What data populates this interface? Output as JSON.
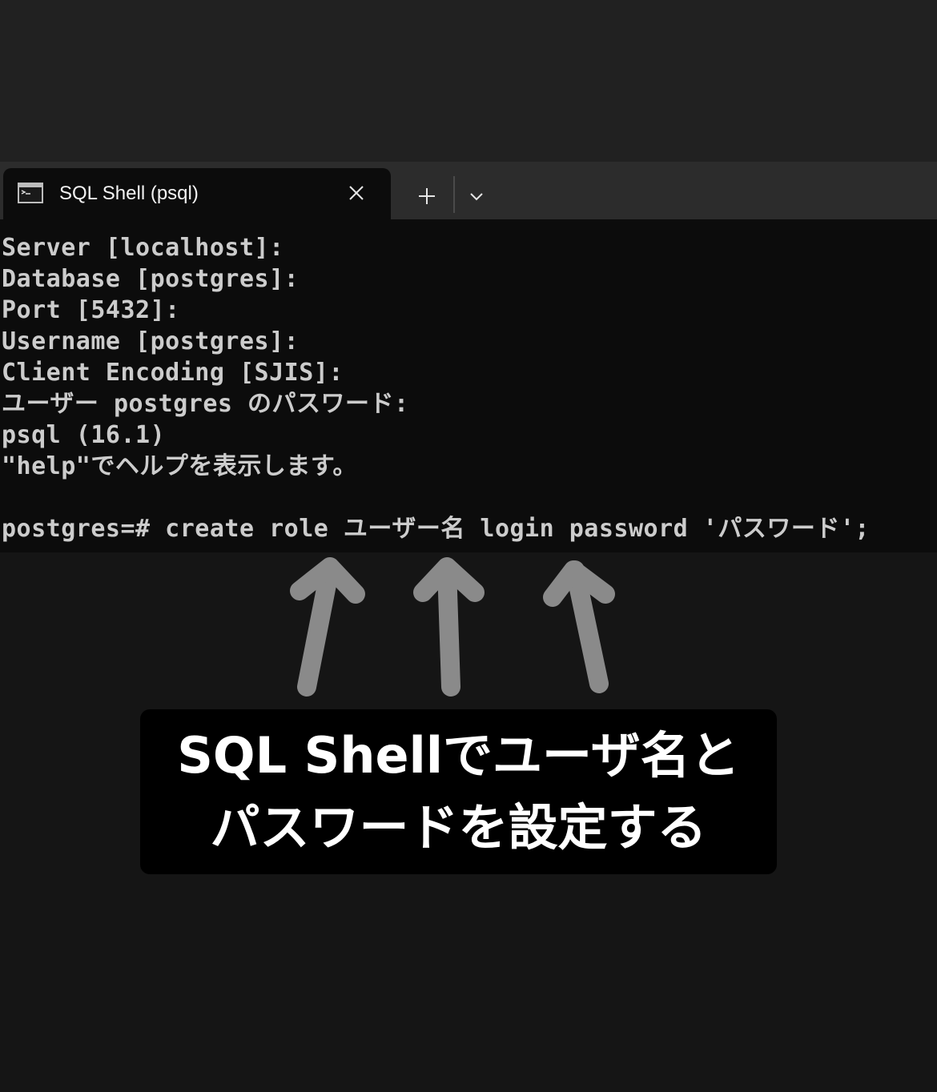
{
  "tab": {
    "title": "SQL Shell (psql)",
    "icon": "terminal-icon"
  },
  "tabbar": {
    "close_icon": "close-icon",
    "new_tab_icon": "plus-icon",
    "dropdown_icon": "chevron-down-icon"
  },
  "console": {
    "lines": [
      "Server [localhost]:",
      "Database [postgres]:",
      "Port [5432]:",
      "Username [postgres]:",
      "Client Encoding [SJIS]:",
      "ユーザー postgres のパスワード:",
      "psql (16.1)",
      "\"help\"でヘルプを表示します。",
      "",
      "postgres=# create role ユーザー名 login password 'パスワード';"
    ]
  },
  "annotation": {
    "arrows": [
      "arrow-up-icon",
      "arrow-up-icon",
      "arrow-up-icon"
    ],
    "caption_line1": "SQL Shellでユーザ名と",
    "caption_line2": "パスワードを設定する"
  },
  "colors": {
    "background": "#151515",
    "console_bg": "#0c0c0c",
    "console_text": "#cccccc",
    "arrow": "#8a8a8a",
    "caption_bg": "#000000",
    "caption_text": "#ffffff"
  }
}
